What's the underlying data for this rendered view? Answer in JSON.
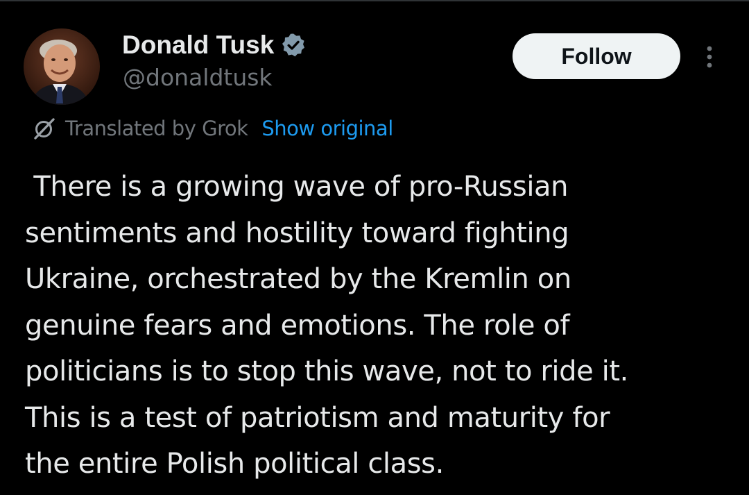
{
  "author": {
    "display_name": "Donald Tusk",
    "handle": "@donaldtusk",
    "verified": true,
    "avatar_icon": "profile-photo"
  },
  "actions": {
    "follow_label": "Follow",
    "more_icon": "more-vertical-icon"
  },
  "translation": {
    "icon": "grok-icon",
    "label": "Translated by Grok",
    "show_original_label": "Show original"
  },
  "tweet": {
    "text": " There is a growing wave of pro-Russian\nsentiments and hostility toward fighting\nUkraine, orchestrated by the Kremlin on\ngenuine fears and emotions. The role of\npoliticians is to stop this wave, not to ride it.\nThis is a test of patriotism and maturity for\nthe entire Polish political class."
  },
  "colors": {
    "background": "#000000",
    "primary_text": "#e7e9ea",
    "secondary_text": "#71767b",
    "link": "#1d9bf0",
    "verified_badge": "#829aab",
    "follow_bg": "#eff3f4",
    "follow_text": "#0f1419"
  }
}
